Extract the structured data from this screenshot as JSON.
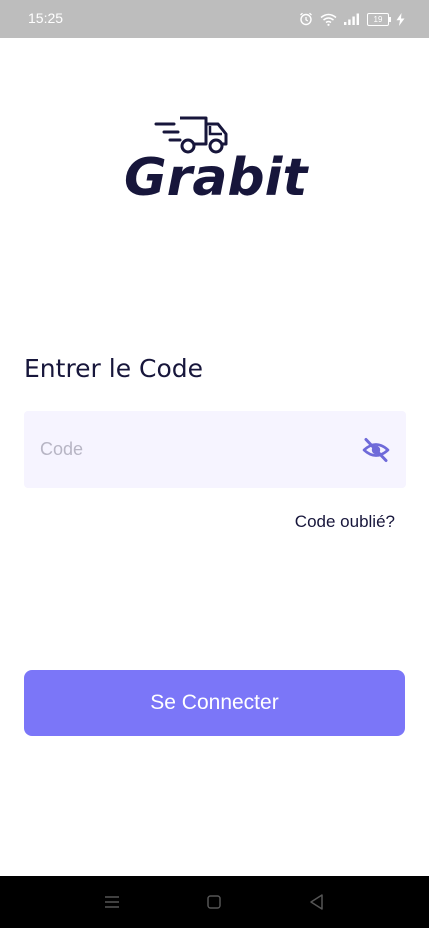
{
  "status_bar": {
    "time": "15:25",
    "battery_level": "19",
    "icons": [
      "alarm-icon",
      "wifi-icon",
      "signal-icon",
      "battery-icon",
      "charging-icon"
    ]
  },
  "logo": {
    "text": "Grabit",
    "icon": "delivery-truck-icon"
  },
  "login": {
    "heading": "Entrer le Code",
    "code_placeholder": "Code",
    "code_value": "",
    "visibility_icon": "eye-off-icon",
    "forgot_label": "Code oublié?",
    "submit_label": "Se Connecter"
  },
  "nav_bar": {
    "icons": [
      "menu-icon",
      "home-icon",
      "back-icon"
    ]
  },
  "colors": {
    "primary": "#7b76f8",
    "text_dark": "#17163b",
    "input_bg": "#f6f4ff",
    "status_bar_bg": "#bdbdbd"
  }
}
